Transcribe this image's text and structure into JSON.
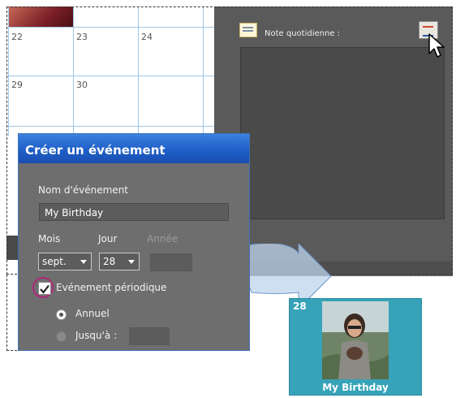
{
  "calendar": {
    "days": [
      "22",
      "23",
      "24",
      "29",
      "30"
    ]
  },
  "note_panel": {
    "label": "Note quotidienne :"
  },
  "dialog": {
    "title": "Créer un événement",
    "event_name_label": "Nom d'événement",
    "event_name_value": "My Birthday",
    "month_label": "Mois",
    "day_label": "Jour",
    "year_label": "Année",
    "month_value": "sept.",
    "day_value": "28",
    "recurring_checkbox": {
      "label": "Evénement périodique",
      "checked": true
    },
    "radio_annual": {
      "label": "Annuel",
      "selected": true
    },
    "radio_until": {
      "label": "Jusqu'à :",
      "selected": false
    }
  },
  "card": {
    "date": "28",
    "label": "My Birthday"
  },
  "colors": {
    "accent_blue": "#1f5fc7",
    "dialog_bg": "#6e6e6e",
    "card_teal": "#37a3b8",
    "highlight_ring": "#b0277a"
  }
}
